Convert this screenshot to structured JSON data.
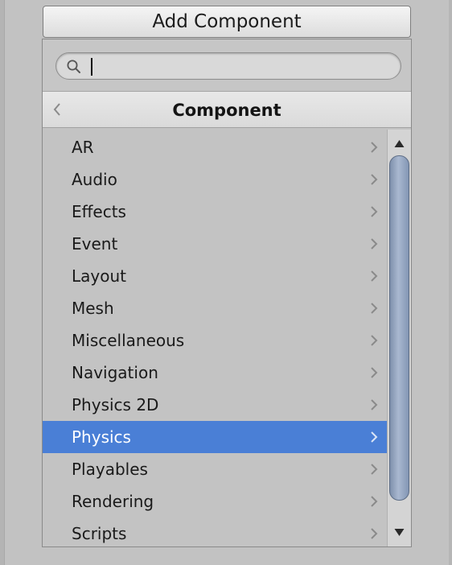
{
  "add_component_button": {
    "label": "Add Component"
  },
  "search": {
    "value": "",
    "placeholder": "",
    "icon": "search-icon"
  },
  "header": {
    "title": "Component",
    "back_icon": "chevron-left-icon"
  },
  "list": {
    "items": [
      {
        "label": "AR",
        "selected": false
      },
      {
        "label": "Audio",
        "selected": false
      },
      {
        "label": "Effects",
        "selected": false
      },
      {
        "label": "Event",
        "selected": false
      },
      {
        "label": "Layout",
        "selected": false
      },
      {
        "label": "Mesh",
        "selected": false
      },
      {
        "label": "Miscellaneous",
        "selected": false
      },
      {
        "label": "Navigation",
        "selected": false
      },
      {
        "label": "Physics 2D",
        "selected": false
      },
      {
        "label": "Physics",
        "selected": true
      },
      {
        "label": "Playables",
        "selected": false
      },
      {
        "label": "Rendering",
        "selected": false
      },
      {
        "label": "Scripts",
        "selected": false
      }
    ],
    "item_icon": "chevron-right-icon",
    "selection_color": "#4a7fd6"
  },
  "scrollbar": {
    "up_icon": "triangle-up-icon",
    "down_icon": "triangle-down-icon",
    "visible_fraction": 0.95,
    "position": 0.0
  }
}
